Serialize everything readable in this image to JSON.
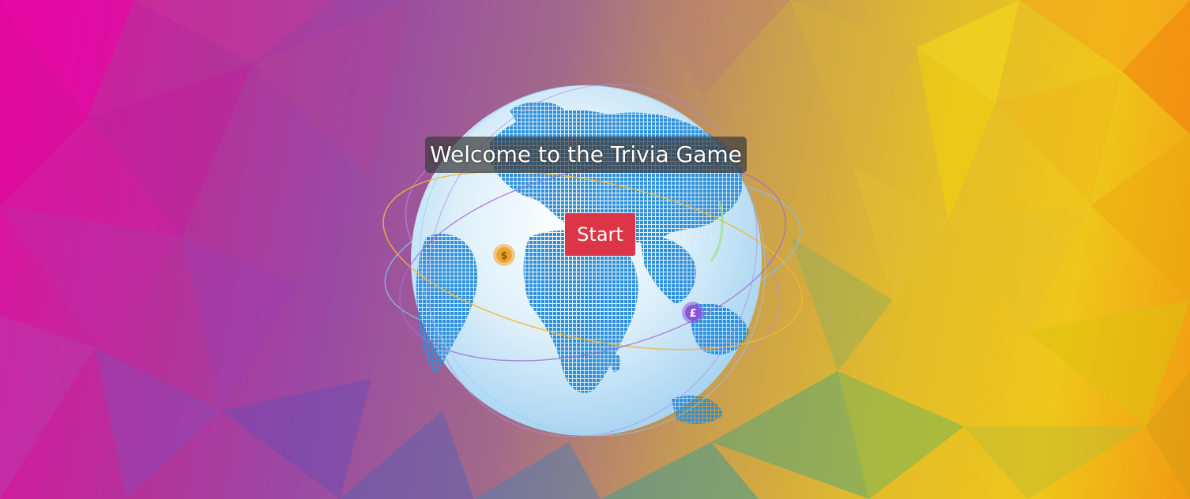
{
  "page": {
    "title": "Welcome to the Trivia Game",
    "start_label": "Start"
  },
  "globe": {
    "coin_dollar_symbol": "$",
    "coin_pound_symbol": "£"
  },
  "colors": {
    "start_button": "#dc3545",
    "title_background": "rgba(60,60,60,0.72)",
    "globe_ocean": "#cfe9f8",
    "globe_land": "#2f8fd8",
    "coin_dollar": "#f0a430",
    "coin_pound": "#8a54d6"
  }
}
